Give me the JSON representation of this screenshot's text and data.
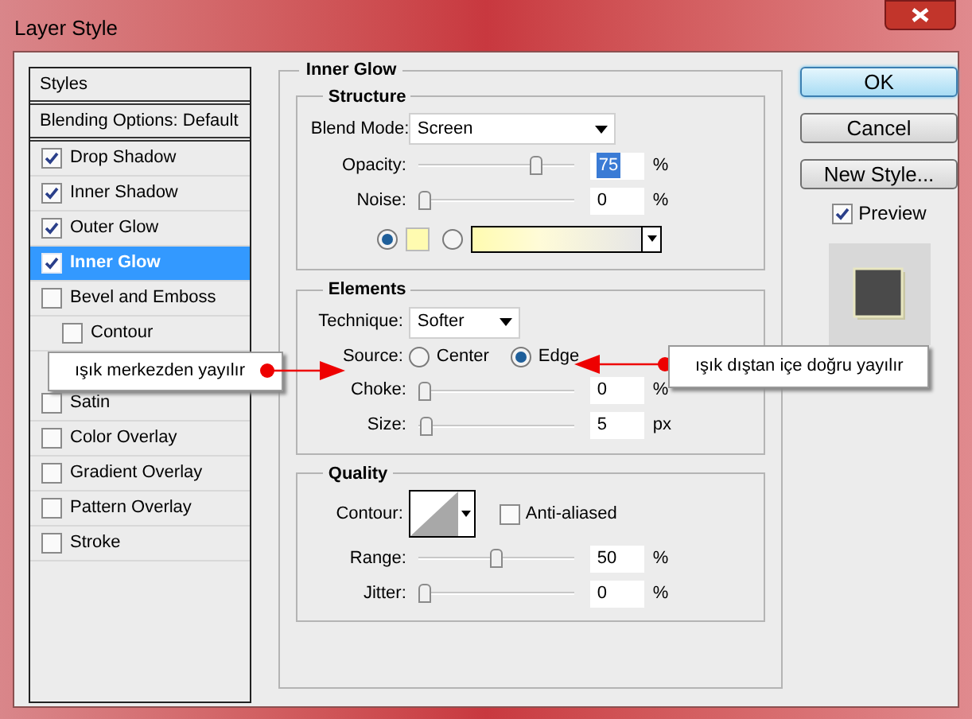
{
  "window": {
    "title": "Layer Style"
  },
  "styles_list": [
    {
      "kind": "header",
      "label": "Styles",
      "selected": false
    },
    {
      "kind": "header",
      "label": "Blending Options: Default",
      "selected": false
    },
    {
      "kind": "checkbox",
      "label": "Drop Shadow",
      "checked": true,
      "selected": false
    },
    {
      "kind": "checkbox",
      "label": "Inner Shadow",
      "checked": true,
      "selected": false
    },
    {
      "kind": "checkbox",
      "label": "Outer Glow",
      "checked": true,
      "selected": false
    },
    {
      "kind": "checkbox",
      "label": "Inner Glow",
      "checked": true,
      "selected": true
    },
    {
      "kind": "checkbox",
      "label": "Bevel and Emboss",
      "checked": false,
      "selected": false,
      "children": [
        {
          "kind": "checkbox",
          "label": "Contour",
          "checked": false,
          "selected": false
        }
      ]
    },
    {
      "kind": "checkbox",
      "label": "Satin",
      "checked": false,
      "selected": false
    },
    {
      "kind": "checkbox",
      "label": "Color Overlay",
      "checked": false,
      "selected": false
    },
    {
      "kind": "checkbox",
      "label": "Gradient Overlay",
      "checked": false,
      "selected": false
    },
    {
      "kind": "checkbox",
      "label": "Pattern Overlay",
      "checked": false,
      "selected": false
    },
    {
      "kind": "checkbox",
      "label": "Stroke",
      "checked": false,
      "selected": false
    }
  ],
  "panel": {
    "title": "Inner Glow",
    "structure": {
      "title": "Structure",
      "blend_mode": {
        "label": "Blend Mode:",
        "value": "Screen"
      },
      "sliders": [
        {
          "label": "Opacity:",
          "level": 0.75,
          "value": "75",
          "unit": "%",
          "highlighted": true
        },
        {
          "label": "Noise:",
          "level": 0,
          "value": "0",
          "unit": "%",
          "highlighted": false
        }
      ],
      "fill_types": [
        {
          "kind": "solid",
          "selected": true
        },
        {
          "kind": "gradient",
          "selected": false
        }
      ]
    },
    "elements": {
      "title": "Elements",
      "technique": {
        "label": "Technique:",
        "value": "Softer"
      },
      "source": {
        "label": "Source:",
        "options": [
          {
            "label": "Center",
            "selected": false
          },
          {
            "label": "Edge",
            "selected": true
          }
        ]
      },
      "sliders": [
        {
          "label": "Choke:",
          "level": 0,
          "value": "0",
          "unit": "%",
          "highlighted": false
        },
        {
          "label": "Size:",
          "level": 0.05,
          "value": "5",
          "unit": "px",
          "highlighted": false
        }
      ]
    },
    "quality": {
      "title": "Quality",
      "contour": {
        "label": "Contour:"
      },
      "anti_aliased": {
        "label": "Anti-aliased",
        "checked": false
      },
      "sliders": [
        {
          "label": "Range:",
          "level": 0.5,
          "value": "50",
          "unit": "%",
          "highlighted": false
        },
        {
          "label": "Jitter:",
          "level": 0,
          "value": "0",
          "unit": "%",
          "highlighted": false
        }
      ]
    }
  },
  "buttons": [
    {
      "label": "OK",
      "default": true
    },
    {
      "label": "Cancel",
      "default": false
    },
    {
      "label": "New Style...",
      "default": false
    }
  ],
  "preview": {
    "label": "Preview",
    "checked": true
  },
  "annotations": [
    {
      "text": "ışık merkezden yayılır"
    },
    {
      "text": "ışık dıştan içe doğru yayılır"
    }
  ]
}
